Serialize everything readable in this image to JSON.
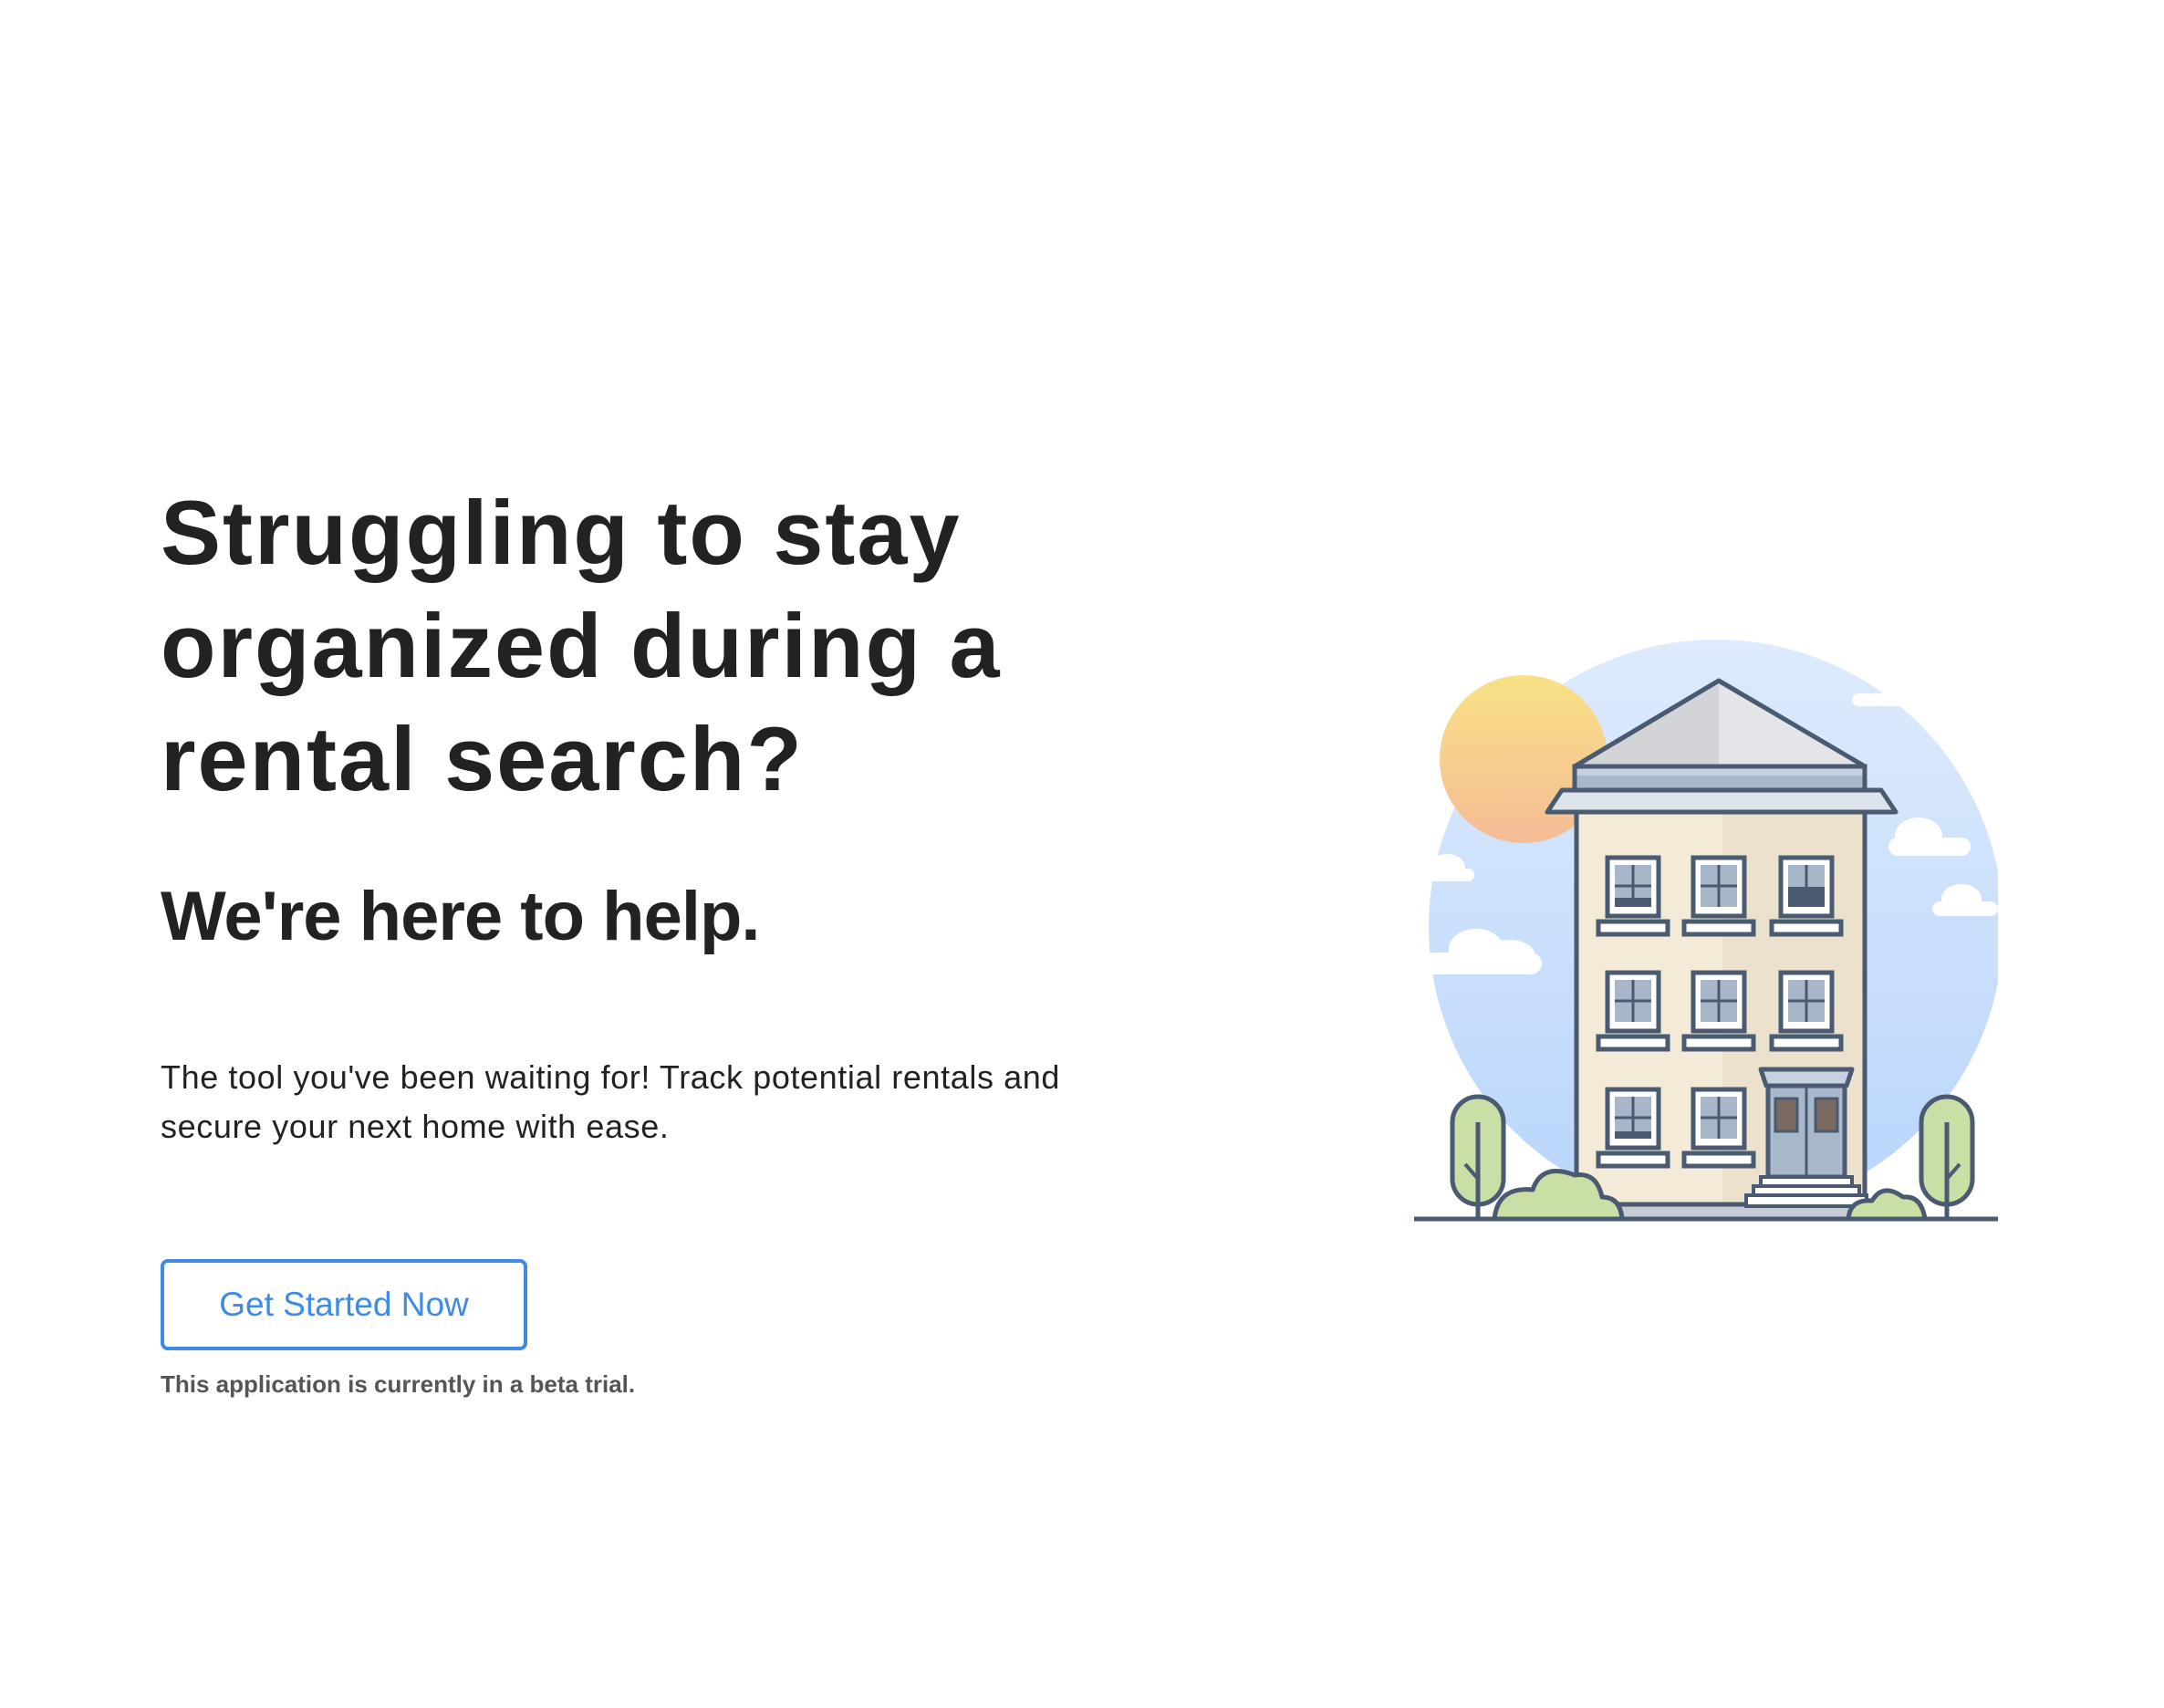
{
  "hero": {
    "headline": "Struggling to stay organized during a rental search?",
    "subheadline": "We're here to help.",
    "description": "The tool you've been waiting for! Track potential rentals and secure your next home with ease.",
    "cta_label": "Get Started Now",
    "beta_note": "This application is currently in a beta trial."
  },
  "illustration": {
    "name": "apartment-building-illustration",
    "sky_color": "#cfe3fb",
    "sun_color": "#f7d88a",
    "building_color": "#f3ead8",
    "roof_color": "#d7d7d9",
    "outline_color": "#4a5a70",
    "tree_color": "#c9dfa6"
  },
  "colors": {
    "accent": "#3d8be6",
    "text": "#222222",
    "muted": "#555555"
  }
}
